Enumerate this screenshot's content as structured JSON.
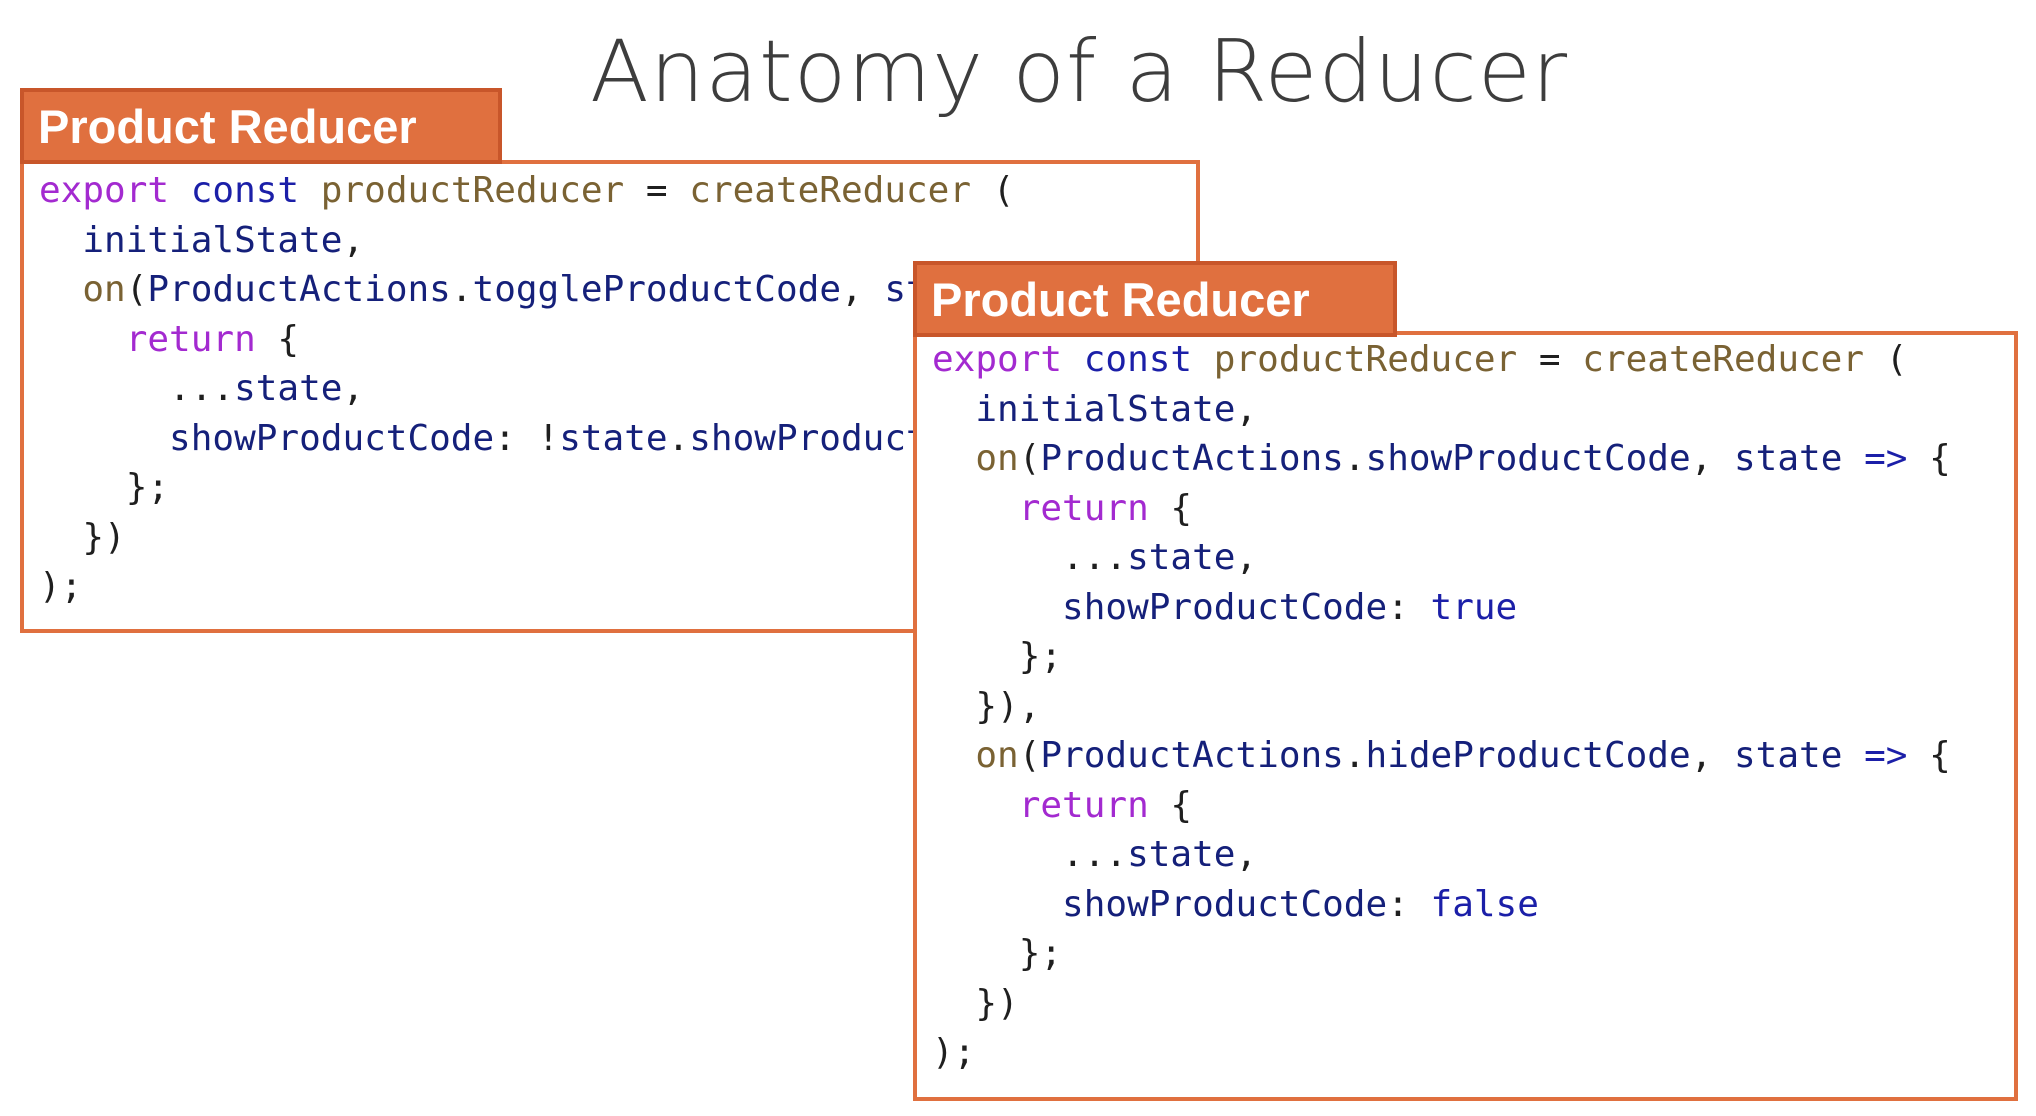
{
  "slide": {
    "title": "Anatomy of a Reducer"
  },
  "colors": {
    "accent_orange": "#e0703f",
    "accent_orange_border": "#c8562a",
    "keyword_purple": "#a32ad0",
    "keyword_blue": "#1b1fa8",
    "function_brown": "#7a6233",
    "identifier_navy": "#15207a"
  },
  "panels": [
    {
      "title": "Product Reducer",
      "lines": [
        [
          [
            "kw-purple",
            "export"
          ],
          [
            "plain",
            " "
          ],
          [
            "kw-blue",
            "const"
          ],
          [
            "plain",
            " "
          ],
          [
            "fn",
            "productReducer"
          ],
          [
            "plain",
            " = "
          ],
          [
            "fn",
            "createReducer"
          ],
          [
            "plain",
            " ("
          ]
        ],
        [
          [
            "plain",
            "  "
          ],
          [
            "id",
            "initialState"
          ],
          [
            "plain",
            ","
          ]
        ],
        [
          [
            "plain",
            "  "
          ],
          [
            "fn",
            "on"
          ],
          [
            "plain",
            "("
          ],
          [
            "id",
            "ProductActions"
          ],
          [
            "plain",
            "."
          ],
          [
            "id",
            "toggleProductCode"
          ],
          [
            "plain",
            ", "
          ],
          [
            "id",
            "state"
          ],
          [
            "plain",
            " "
          ],
          [
            "kw-blue",
            "=>"
          ],
          [
            "plain",
            " {"
          ]
        ],
        [
          [
            "plain",
            "    "
          ],
          [
            "kw-purple",
            "return"
          ],
          [
            "plain",
            " {"
          ]
        ],
        [
          [
            "plain",
            "      ..."
          ],
          [
            "id",
            "state"
          ],
          [
            "plain",
            ","
          ]
        ],
        [
          [
            "plain",
            "      "
          ],
          [
            "id",
            "showProductCode"
          ],
          [
            "plain",
            ": !"
          ],
          [
            "id",
            "state"
          ],
          [
            "plain",
            "."
          ],
          [
            "id",
            "showProductCode"
          ]
        ],
        [
          [
            "plain",
            "    };"
          ]
        ],
        [
          [
            "plain",
            "  })"
          ]
        ],
        [
          [
            "plain",
            ");"
          ]
        ]
      ]
    },
    {
      "title": "Product Reducer",
      "lines": [
        [
          [
            "kw-purple",
            "export"
          ],
          [
            "plain",
            " "
          ],
          [
            "kw-blue",
            "const"
          ],
          [
            "plain",
            " "
          ],
          [
            "fn",
            "productReducer"
          ],
          [
            "plain",
            " = "
          ],
          [
            "fn",
            "createReducer"
          ],
          [
            "plain",
            " ("
          ]
        ],
        [
          [
            "plain",
            "  "
          ],
          [
            "id",
            "initialState"
          ],
          [
            "plain",
            ","
          ]
        ],
        [
          [
            "plain",
            "  "
          ],
          [
            "fn",
            "on"
          ],
          [
            "plain",
            "("
          ],
          [
            "id",
            "ProductActions"
          ],
          [
            "plain",
            "."
          ],
          [
            "id",
            "showProductCode"
          ],
          [
            "plain",
            ", "
          ],
          [
            "id",
            "state"
          ],
          [
            "plain",
            " "
          ],
          [
            "kw-blue",
            "=>"
          ],
          [
            "plain",
            " {"
          ]
        ],
        [
          [
            "plain",
            "    "
          ],
          [
            "kw-purple",
            "return"
          ],
          [
            "plain",
            " {"
          ]
        ],
        [
          [
            "plain",
            "      ..."
          ],
          [
            "id",
            "state"
          ],
          [
            "plain",
            ","
          ]
        ],
        [
          [
            "plain",
            "      "
          ],
          [
            "id",
            "showProductCode"
          ],
          [
            "plain",
            ": "
          ],
          [
            "kw-blue",
            "true"
          ]
        ],
        [
          [
            "plain",
            "    };"
          ]
        ],
        [
          [
            "plain",
            "  }),"
          ]
        ],
        [
          [
            "plain",
            "  "
          ],
          [
            "fn",
            "on"
          ],
          [
            "plain",
            "("
          ],
          [
            "id",
            "ProductActions"
          ],
          [
            "plain",
            "."
          ],
          [
            "id",
            "hideProductCode"
          ],
          [
            "plain",
            ", "
          ],
          [
            "id",
            "state"
          ],
          [
            "plain",
            " "
          ],
          [
            "kw-blue",
            "=>"
          ],
          [
            "plain",
            " {"
          ]
        ],
        [
          [
            "plain",
            "    "
          ],
          [
            "kw-purple",
            "return"
          ],
          [
            "plain",
            " {"
          ]
        ],
        [
          [
            "plain",
            "      ..."
          ],
          [
            "id",
            "state"
          ],
          [
            "plain",
            ","
          ]
        ],
        [
          [
            "plain",
            "      "
          ],
          [
            "id",
            "showProductCode"
          ],
          [
            "plain",
            ": "
          ],
          [
            "kw-blue",
            "false"
          ]
        ],
        [
          [
            "plain",
            "    };"
          ]
        ],
        [
          [
            "plain",
            "  })"
          ]
        ],
        [
          [
            "plain",
            ");"
          ]
        ]
      ]
    }
  ]
}
